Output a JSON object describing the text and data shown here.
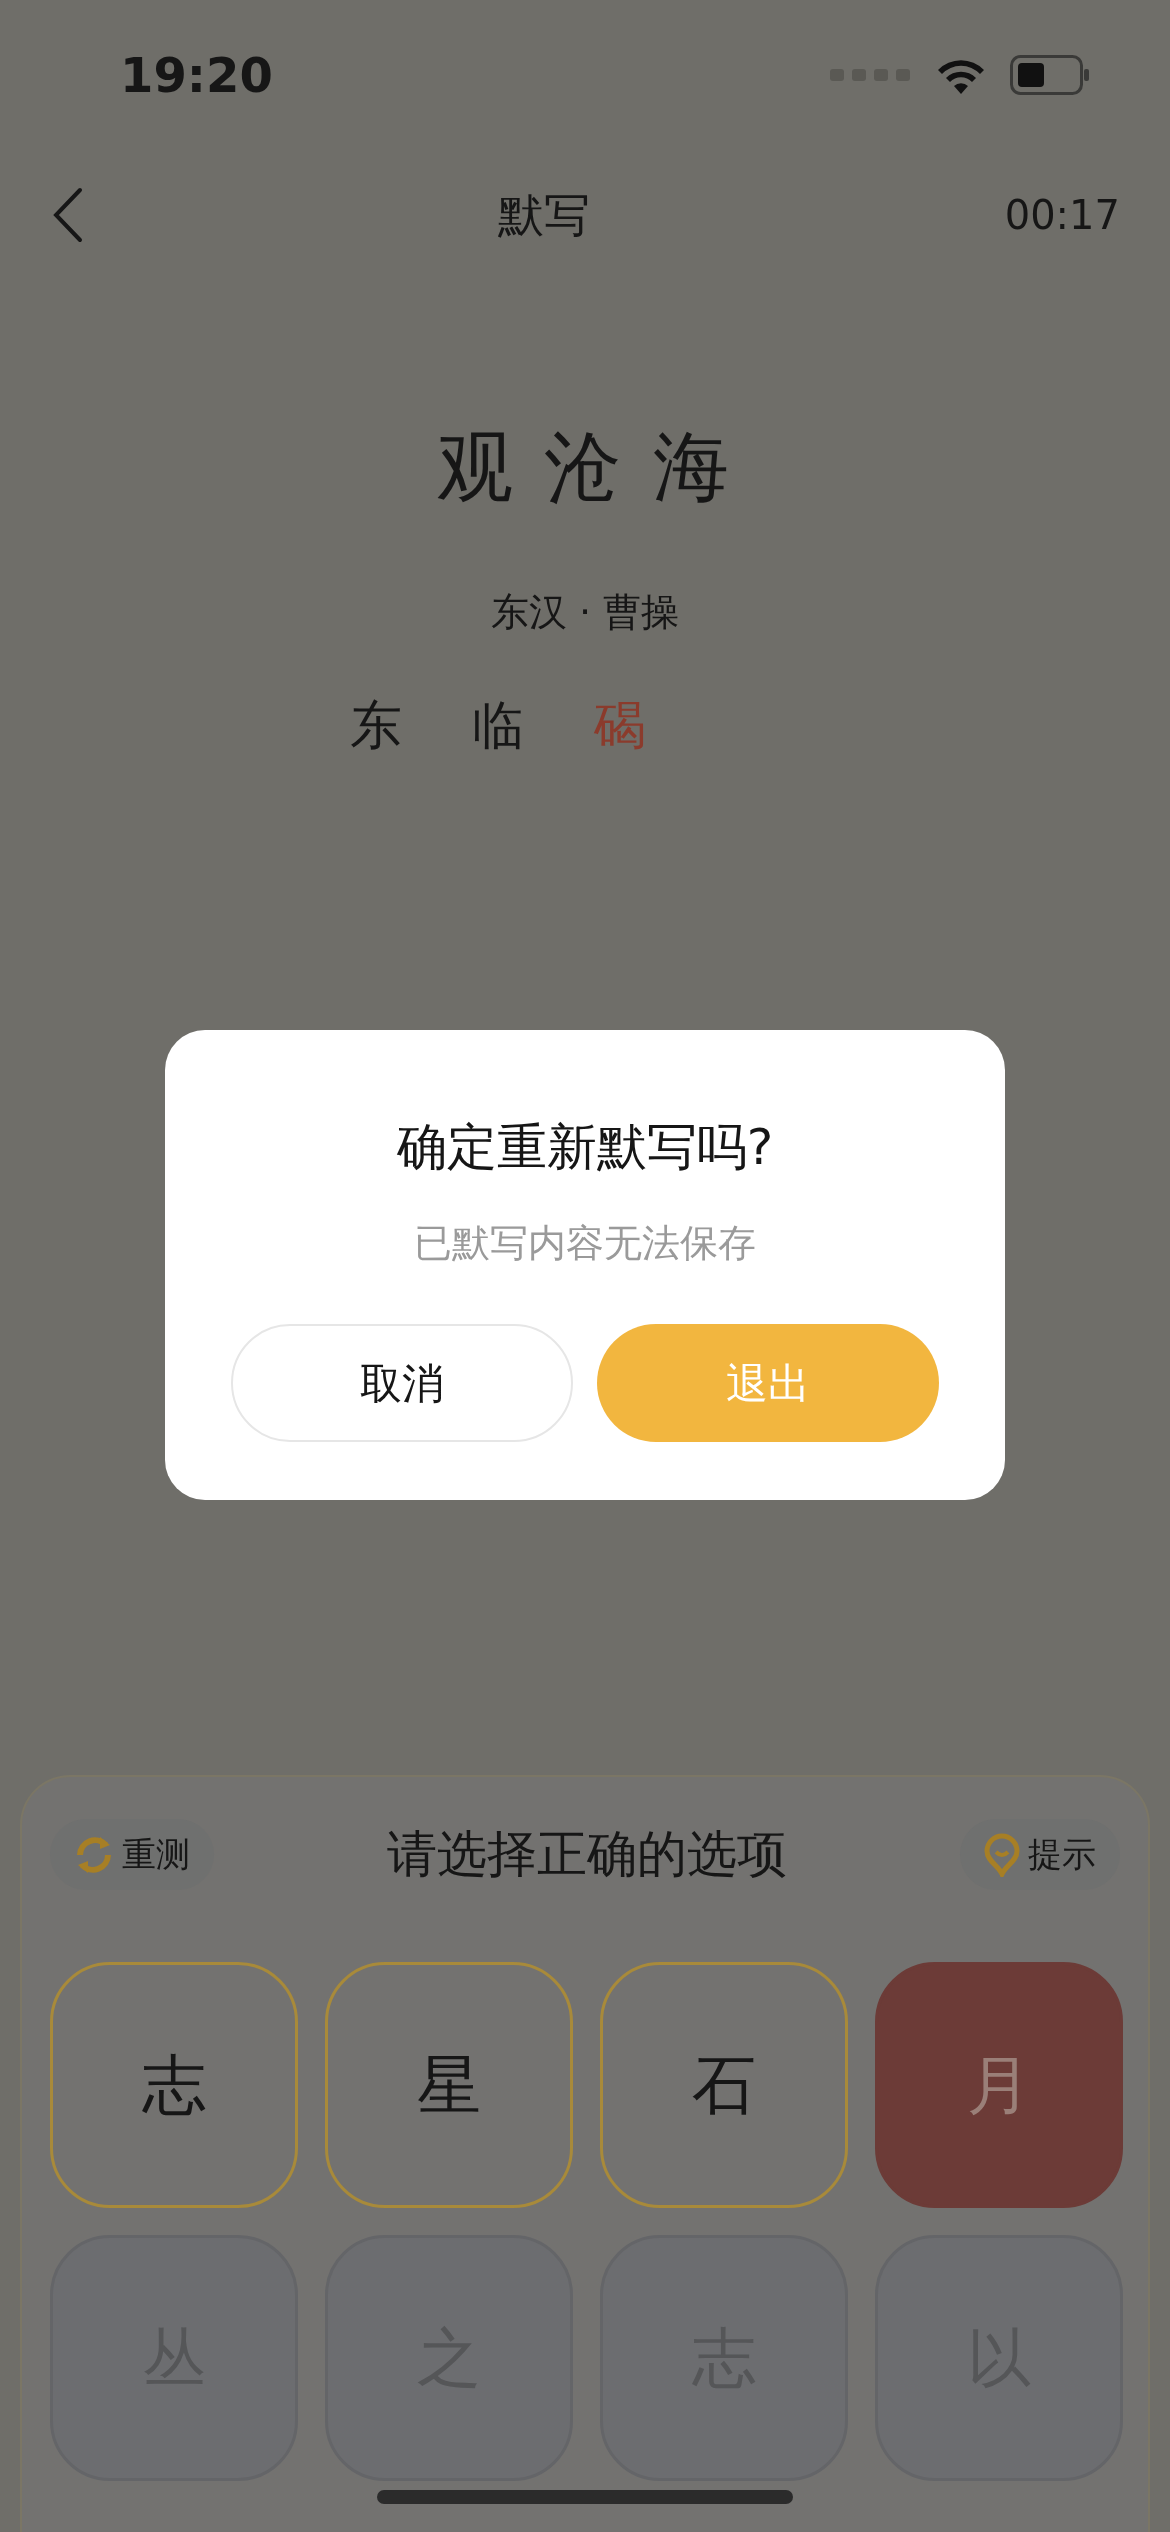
{
  "status_bar": {
    "time": "19:20"
  },
  "nav": {
    "title": "默写",
    "timer": "00:17"
  },
  "poem": {
    "title": "观 沧 海",
    "author": "东汉 · 曹操"
  },
  "answers": [
    {
      "char": "东",
      "wrong": false
    },
    {
      "char": "临",
      "wrong": false
    },
    {
      "char": "碣",
      "wrong": true
    }
  ],
  "panel": {
    "retest": "重测",
    "prompt": "请选择正确的选项",
    "hint": "提示"
  },
  "options": [
    {
      "char": "志",
      "selected": false,
      "disabled": false
    },
    {
      "char": "星",
      "selected": false,
      "disabled": false
    },
    {
      "char": "石",
      "selected": false,
      "disabled": false
    },
    {
      "char": "月",
      "selected": true,
      "disabled": false
    },
    {
      "char": "丛",
      "selected": false,
      "disabled": true
    },
    {
      "char": "之",
      "selected": false,
      "disabled": true
    },
    {
      "char": "志",
      "selected": false,
      "disabled": true
    },
    {
      "char": "以",
      "selected": false,
      "disabled": true
    }
  ],
  "dialog": {
    "title": "确定重新默写吗?",
    "message": "已默写内容无法保存",
    "buttons": [
      {
        "label": "取消",
        "kind": "secondary"
      },
      {
        "label": "退出",
        "kind": "primary"
      }
    ]
  }
}
